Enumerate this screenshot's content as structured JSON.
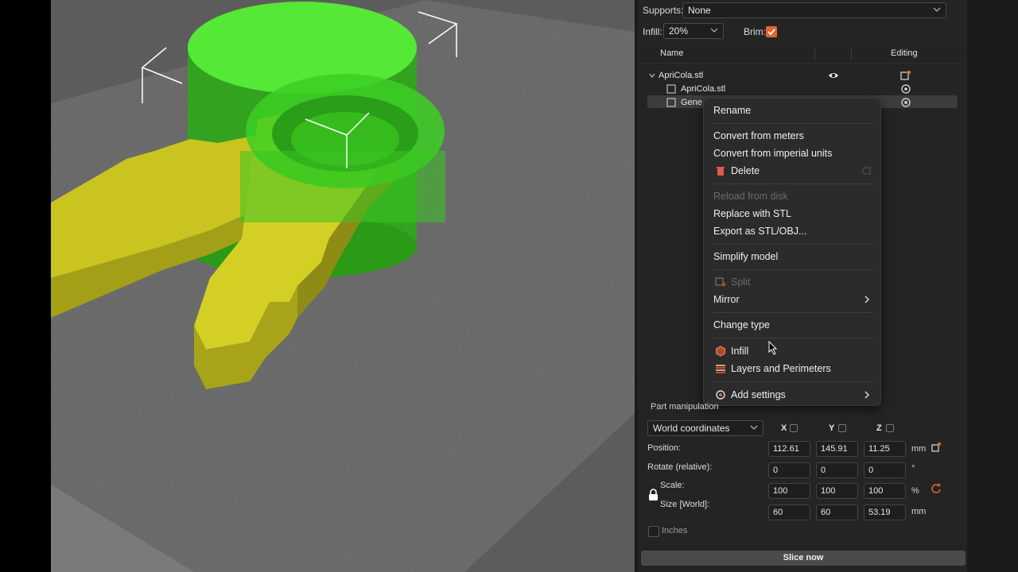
{
  "settings": {
    "supports_label": "Supports:",
    "supports_value": "None",
    "infill_label": "Infill:",
    "infill_value": "20%",
    "brim_label": "Brim:",
    "brim_checked": true
  },
  "object_list": {
    "columns": {
      "name": "Name",
      "editing": "Editing"
    },
    "items": [
      {
        "label": "ApriCola.stl",
        "level": 0,
        "expanded": true
      },
      {
        "label": "ApriCola.stl",
        "level": 1
      },
      {
        "label": "Gene",
        "level": 1,
        "selected": true
      }
    ]
  },
  "context_menu": {
    "rename": "Rename",
    "convert_meters": "Convert from meters",
    "convert_imperial": "Convert from imperial units",
    "delete": "Delete",
    "reload": "Reload from disk",
    "replace": "Replace with STL",
    "export": "Export as STL/OBJ...",
    "simplify": "Simplify model",
    "split": "Split",
    "mirror": "Mirror",
    "change_type": "Change type",
    "infill": "Infill",
    "layers": "Layers and Perimeters",
    "add_settings": "Add settings"
  },
  "part_manipulation": {
    "title": "Part manipulation",
    "coords_value": "World coordinates",
    "axes": [
      "X",
      "Y",
      "Z"
    ],
    "position_label": "Position:",
    "position": [
      "112.61",
      "145.91",
      "11.25"
    ],
    "position_unit": "mm",
    "rotate_label": "Rotate (relative):",
    "rotate": [
      "0",
      "0",
      "0"
    ],
    "rotate_unit": "°",
    "scale_label": "Scale:",
    "scale": [
      "100",
      "100",
      "100"
    ],
    "scale_unit": "%",
    "size_label": "Size [World]:",
    "size": [
      "60",
      "60",
      "53.19"
    ],
    "size_unit": "mm",
    "inches_label": "Inches"
  },
  "slice_button": "Slice now",
  "colors": {
    "accent": "#e2672b",
    "model_yellow": "#c9c420",
    "modifier_green": "#38c81e",
    "bed": "#5c5c5c"
  }
}
